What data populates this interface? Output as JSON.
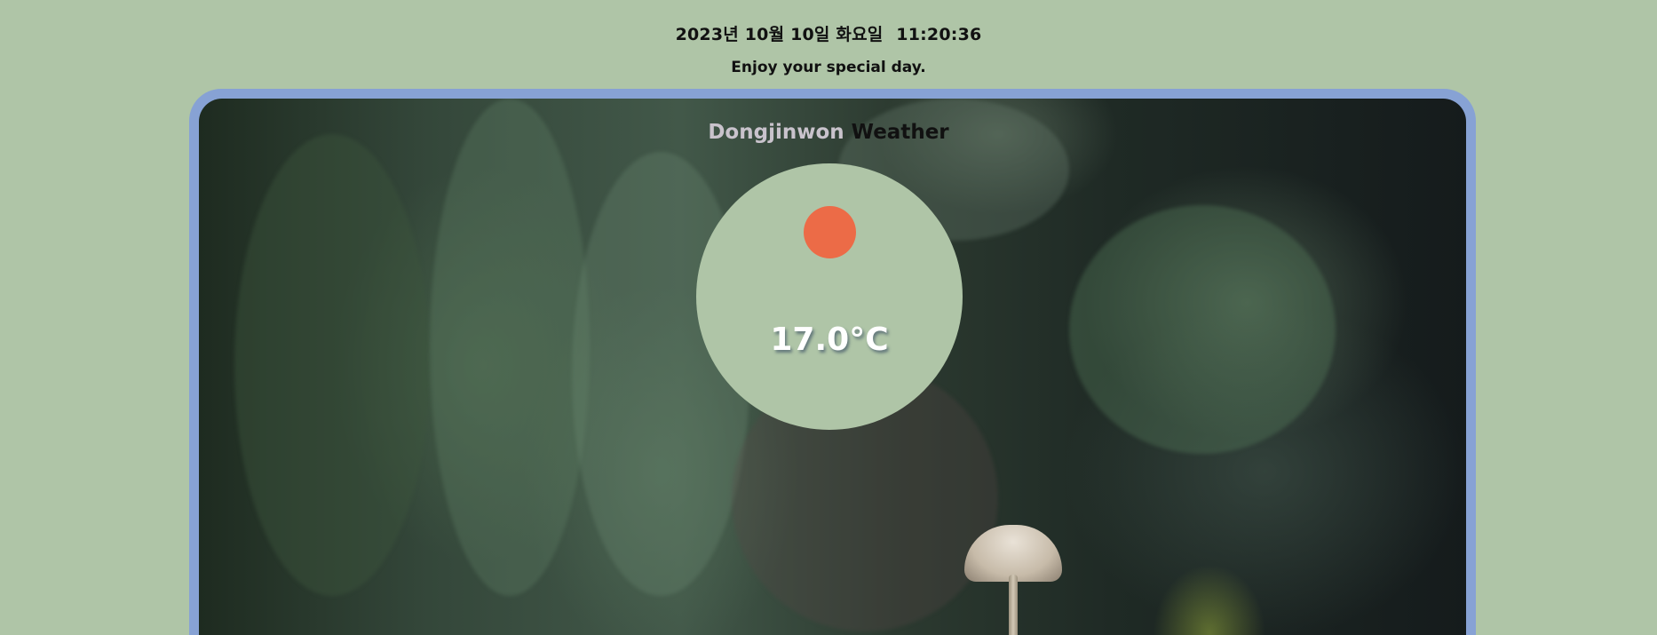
{
  "header": {
    "date": "2023년 10월 10일 화요일",
    "time": "11:20:36",
    "tagline": "Enjoy your special day."
  },
  "app": {
    "title_first": "Dongjinwon",
    "title_second": "Weather"
  },
  "weather": {
    "icon": "sun-icon",
    "temperature": "17.0°C"
  },
  "colors": {
    "background": "#afc5a7",
    "frame": "#87a2d4",
    "sun": "#ec6b47",
    "circle": "#afc5a7"
  }
}
